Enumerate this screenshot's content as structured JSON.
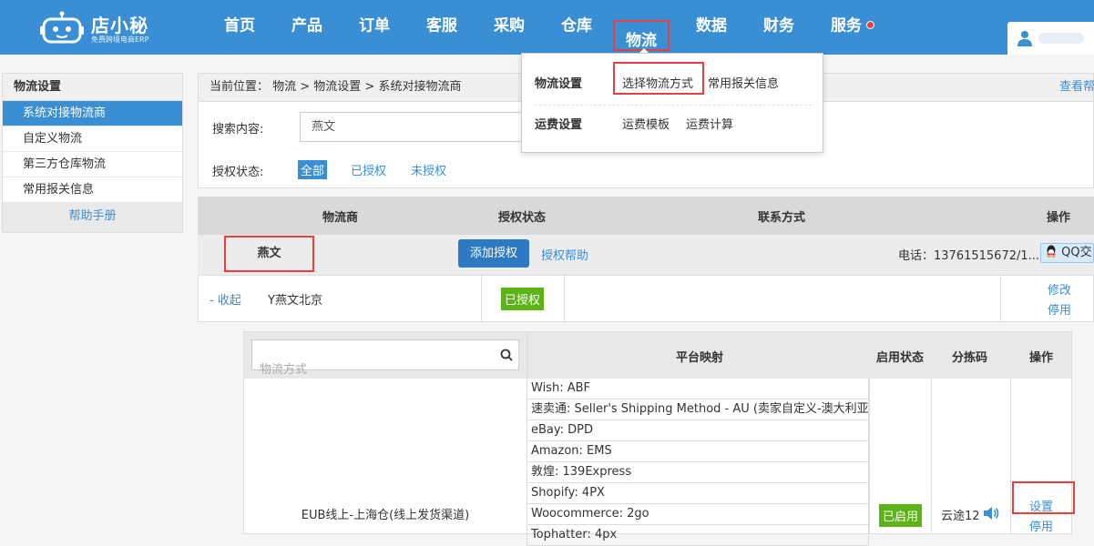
{
  "brand": {
    "name": "店小秘",
    "tagline": "免费跨境电商ERP"
  },
  "nav": [
    {
      "label": "首页"
    },
    {
      "label": "产品"
    },
    {
      "label": "订单"
    },
    {
      "label": "客服"
    },
    {
      "label": "采购"
    },
    {
      "label": "仓库"
    },
    {
      "label": "物流"
    },
    {
      "label": "数据"
    },
    {
      "label": "财务"
    },
    {
      "label": "服务"
    }
  ],
  "nav_active": "物流",
  "dropdown": {
    "group1": {
      "title": "物流设置",
      "items": [
        "选择物流方式",
        "常用报关信息"
      ]
    },
    "group2": {
      "title": "运费设置",
      "items": [
        "运费模板",
        "运费计算"
      ]
    }
  },
  "sidebar": {
    "title": "物流设置",
    "items": [
      "系统对接物流商",
      "自定义物流",
      "第三方仓库物流",
      "常用报关信息"
    ],
    "help": "帮助手册"
  },
  "breadcrumb": {
    "text": "当前位置： 物流 >  物流设置 > 系统对接物流商",
    "help_link": "查看帮"
  },
  "search": {
    "label": "搜索内容:",
    "value": "燕文"
  },
  "auth_filter": {
    "label": "授权状态:",
    "options": [
      "全部",
      "已授权",
      "未授权"
    ]
  },
  "list_headers": {
    "carrier": "物流商",
    "status": "授权状态",
    "contact": "联系方式",
    "ops": "操作"
  },
  "carrier": {
    "name": "燕文",
    "add_auth": "添加授权",
    "auth_help": "授权帮助",
    "phone": "电话：13761515672/1...",
    "qq": "QQ交"
  },
  "account_row": {
    "collapse": "- 收起",
    "account": "Y燕文北京",
    "status": "已授权",
    "edit": "修改",
    "disable": "停用"
  },
  "detail": {
    "search_placeholder": "物流方式",
    "headers": {
      "mapping": "平台映射",
      "enabled": "启用状态",
      "sort_code": "分拣码",
      "ops": "操作"
    },
    "method_name": "EUB线上-上海仓(线上发货渠道)",
    "mappings": [
      "Wish:  ABF",
      "速卖通:   Seller's Shipping Method - AU (卖家自定义-澳大利亚)",
      "eBay:  DPD",
      "Amazon:  EMS",
      "敦煌:  139Express",
      "Shopify:  4PX",
      "Woocommerce:  2go",
      "Tophatter:  4px"
    ],
    "enabled": "已启用",
    "sort_code": "云途12",
    "set": "设置",
    "disable": "停用"
  }
}
